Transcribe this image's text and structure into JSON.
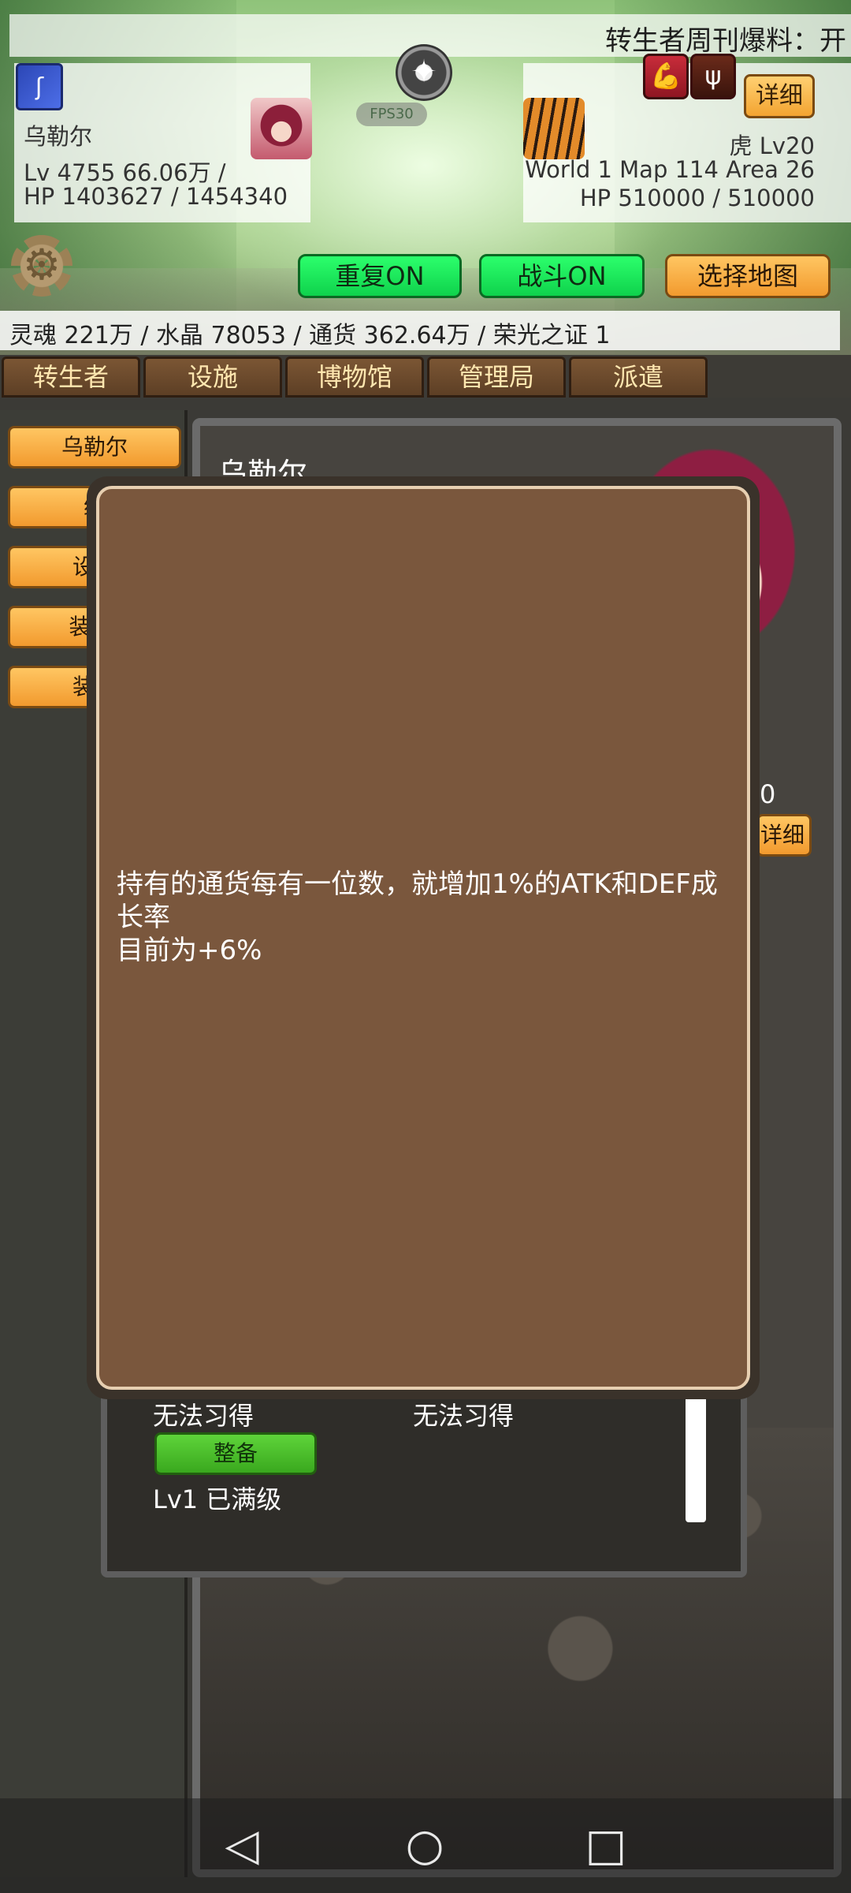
{
  "header": {
    "ticker": "转生者周刊爆料：开",
    "fps": "FPS30",
    "player": {
      "name": "乌勒尔",
      "level_line": "Lv 4755 66.06万 /",
      "hp_line": "HP 1403627 / 1454340"
    },
    "enemy": {
      "name_level": "虎 Lv20",
      "location": "World 1 Map 114 Area 26",
      "hp_line": "HP 510000 / 510000"
    },
    "detail_button": "详细",
    "repeat_button": "重复ON",
    "battle_button": "战斗ON",
    "map_button": "选择地图",
    "currency_line": "灵魂 221万 / 水晶 78053 / 通货 362.64万 / 荣光之证 1"
  },
  "tabs": [
    "转生者",
    "设施",
    "博物馆",
    "管理局",
    "派遣"
  ],
  "sidebar": {
    "items": [
      "乌勒尔",
      "维",
      "设置",
      "装备.",
      "装备"
    ]
  },
  "background": {
    "char_name": "乌勒尔",
    "partial_value": "0",
    "detail_partial": "详细",
    "cannot_learn_1": "无法习得",
    "cannot_learn_2": "无法习得",
    "equip_button": "整备",
    "level_status": "Lv1 已满级"
  },
  "modal": {
    "line1": "持有的通货每有一位数，就增加1%的ATK和DEF成长率",
    "line2": "目前为+6%"
  },
  "navbar": {
    "back_icon": "◁",
    "home_icon": "○",
    "recents_icon": "□"
  },
  "icons": {
    "skill": "ʃ",
    "compass": "✦",
    "gear": "⚙",
    "arm": "💪",
    "beast": "ψ"
  }
}
